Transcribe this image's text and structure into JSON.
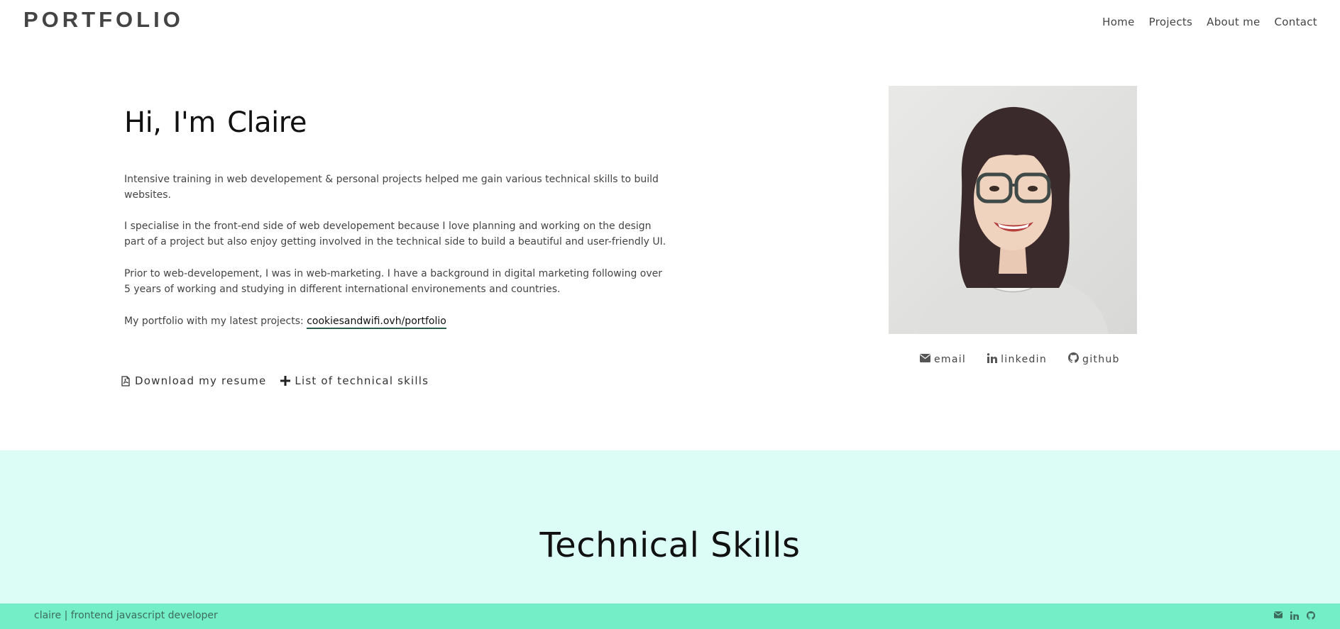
{
  "header": {
    "brand": "PORTFOLIO",
    "nav": [
      "Home",
      "Projects",
      "About me",
      "Contact"
    ]
  },
  "intro": {
    "heading": "Hi, I'm Claire",
    "paragraphs": [
      "Intensive training in web developement & personal projects helped me gain various technical skills to build websites.",
      "I specialise in the front-end side of web developement because I love planning and working on the design part of a project but also enjoy getting involved in the technical side to build a beautiful and user-friendly UI.",
      "Prior to web-developement, I was in web-marketing. I have a background in digital marketing following over 5 years of working and studying in different international environements and countries."
    ],
    "portfolio_prefix": "My portfolio with my latest projects:",
    "portfolio_link": "cookiesandwifi.ovh/portfolio",
    "actions": [
      {
        "label": "Download my resume",
        "icon": "file-pdf-icon"
      },
      {
        "label": "List of technical skills",
        "icon": "plus-icon"
      }
    ]
  },
  "profile": {
    "socials": [
      {
        "label": "email",
        "icon": "envelope-icon"
      },
      {
        "label": "linkedin",
        "icon": "linkedin-icon"
      },
      {
        "label": "github",
        "icon": "github-icon"
      }
    ]
  },
  "skills": {
    "title": "Technical Skills"
  },
  "footer": {
    "text": "claire | frontend javascript developer",
    "icons": [
      "envelope-icon",
      "linkedin-icon",
      "github-icon"
    ]
  },
  "colors": {
    "skills_background": "#dcfdf5",
    "footer_background": "#74eec7",
    "link_underline": "#2a5d4a"
  }
}
